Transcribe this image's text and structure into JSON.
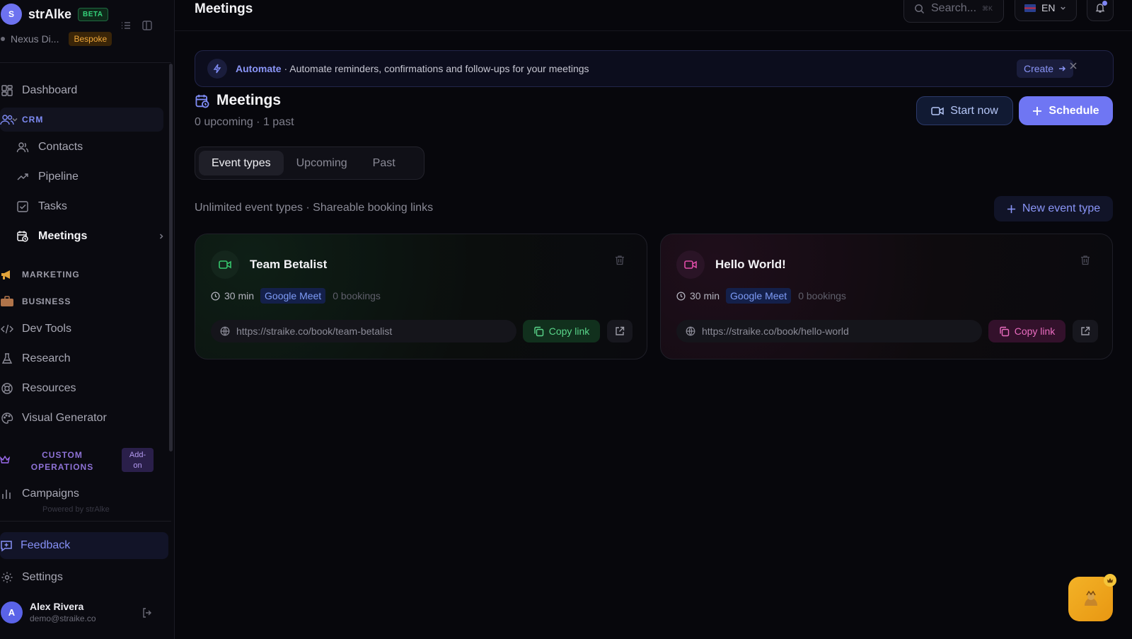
{
  "brand": {
    "avatar": "S",
    "name": "strAlke",
    "badge": "BETA",
    "workspace": "Nexus Di...",
    "workspace_badge": "Bespoke"
  },
  "sidebar": {
    "dashboard": "Dashboard",
    "crm": "CRM",
    "contacts": "Contacts",
    "pipeline": "Pipeline",
    "tasks": "Tasks",
    "meetings": "Meetings",
    "marketing": "MARKETING",
    "business": "BUSINESS",
    "dev_tools": "Dev Tools",
    "research": "Research",
    "resources": "Resources",
    "visual_generator": "Visual Generator",
    "custom_ops_line1": "CUSTOM",
    "custom_ops_line2": "OPERATIONS",
    "addon_line1": "Add-",
    "addon_line2": "on",
    "campaigns": "Campaigns",
    "powered": "Powered by strAlke",
    "feedback": "Feedback",
    "settings": "Settings"
  },
  "user": {
    "avatar": "A",
    "name": "Alex Rivera",
    "email": "demo@straike.co"
  },
  "topbar": {
    "title": "Meetings",
    "search_placeholder": "Search...",
    "search_shortcut": "⌘K",
    "language": "EN"
  },
  "banner": {
    "label": "Automate",
    "text": " · Automate reminders, confirmations and follow-ups for your meetings",
    "create": "Create"
  },
  "page": {
    "title": "Meetings",
    "subtitle": "0 upcoming · 1 past",
    "start_now": "Start now",
    "schedule": "Schedule",
    "tabs": [
      "Event types",
      "Upcoming",
      "Past"
    ],
    "section_text": "Unlimited event types · Shareable booking links",
    "new_event_type": "New event type"
  },
  "event_types": [
    {
      "title": "Team Betalist",
      "duration": "30 min",
      "platform": "Google Meet",
      "bookings": "0 bookings",
      "url": "https://straike.co/book/team-betalist",
      "copy_label": "Copy link",
      "accent": "#36c76d"
    },
    {
      "title": "Hello World!",
      "duration": "30 min",
      "platform": "Google Meet",
      "bookings": "0 bookings",
      "url": "https://straike.co/book/hello-world",
      "copy_label": "Copy link",
      "accent": "#e04da8"
    }
  ],
  "colors": {
    "accent": "#6f76f3",
    "background": "#07070c"
  }
}
